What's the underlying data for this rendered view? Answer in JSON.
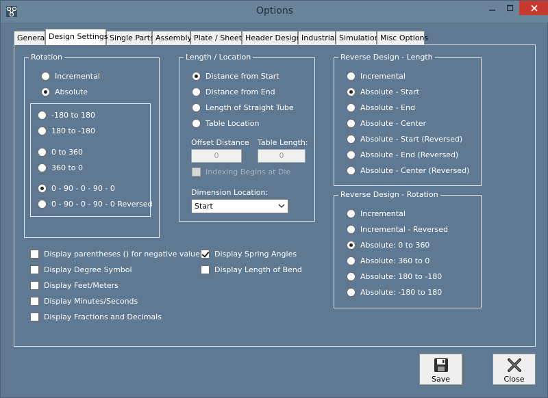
{
  "window": {
    "title": "Options"
  },
  "tabs": [
    {
      "label": "General",
      "active": false
    },
    {
      "label": "Design Settings",
      "active": true
    },
    {
      "label": "Single Parts",
      "active": false
    },
    {
      "label": "Assembly",
      "active": false
    },
    {
      "label": "Plate / Sheet",
      "active": false
    },
    {
      "label": "Header Design",
      "active": false
    },
    {
      "label": "Industrial",
      "active": false
    },
    {
      "label": "Simulation",
      "active": false
    },
    {
      "label": "Misc Options",
      "active": false
    }
  ],
  "rotation": {
    "label": "Rotation",
    "mode": [
      {
        "label": "Incremental",
        "checked": false
      },
      {
        "label": "Absolute",
        "checked": true
      }
    ],
    "ranges": [
      {
        "label": "-180  to  180",
        "checked": false
      },
      {
        "label": "180  to  -180",
        "checked": false
      },
      {
        "label": "0  to  360",
        "checked": false
      },
      {
        "label": "360  to  0",
        "checked": false
      },
      {
        "label": "0 - 90 - 0 - 90 - 0",
        "checked": true
      },
      {
        "label": "0 - 90 - 0 - 90 - 0    Reversed",
        "checked": false
      }
    ]
  },
  "length_location": {
    "label": "Length / Location",
    "options": [
      {
        "label": "Distance from Start",
        "checked": true
      },
      {
        "label": "Distance from End",
        "checked": false
      },
      {
        "label": "Length of Straight Tube",
        "checked": false
      },
      {
        "label": "Table Location",
        "checked": false
      }
    ],
    "offset_distance_label": "Offset Distance",
    "offset_distance_value": "0",
    "table_length_label": "Table Length:",
    "table_length_value": "0",
    "indexing_label": "Indexing Begins at Die",
    "dimension_location_label": "Dimension Location:",
    "dimension_location_value": "Start"
  },
  "reverse_length": {
    "label": "Reverse Design - Length",
    "options": [
      {
        "label": "Incremental",
        "checked": false
      },
      {
        "label": "Absolute - Start",
        "checked": true
      },
      {
        "label": "Absolute - End",
        "checked": false
      },
      {
        "label": "Absolute - Center",
        "checked": false
      },
      {
        "label": "Absolute - Start (Reversed)",
        "checked": false
      },
      {
        "label": "Absolute - End (Reversed)",
        "checked": false
      },
      {
        "label": "Absolute - Center (Reversed)",
        "checked": false
      }
    ]
  },
  "reverse_rotation": {
    "label": "Reverse Design - Rotation",
    "options": [
      {
        "label": "Incremental",
        "checked": false
      },
      {
        "label": "Incremental - Reversed",
        "checked": false
      },
      {
        "label": "Absolute:  0  to  360",
        "checked": true
      },
      {
        "label": "Absolute:  360  to  0",
        "checked": false
      },
      {
        "label": "Absolute:  180  to  -180",
        "checked": false
      },
      {
        "label": "Absolute:  -180  to  180",
        "checked": false
      }
    ]
  },
  "display_left": [
    {
      "label": "Display parentheses () for negative values",
      "checked": false
    },
    {
      "label": "Display Degree Symbol",
      "checked": false
    },
    {
      "label": "Display Feet/Meters",
      "checked": false
    },
    {
      "label": "Display Minutes/Seconds",
      "checked": false
    },
    {
      "label": "Display Fractions and Decimals",
      "checked": false
    }
  ],
  "display_right": [
    {
      "label": "Display Spring Angles",
      "checked": true
    },
    {
      "label": "Display Length of Bend",
      "checked": false
    }
  ],
  "buttons": {
    "save": "Save",
    "close": "Close"
  }
}
